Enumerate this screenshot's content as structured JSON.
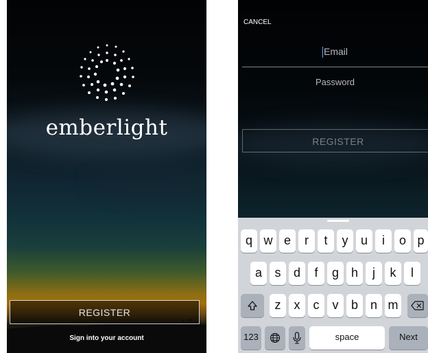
{
  "left_screen": {
    "brand_name": "emberlight",
    "register_button": "REGISTER",
    "sign_in_link": "Sign into your account",
    "logo_icon": "sun-dots-icon"
  },
  "right_screen": {
    "cancel_label": "CANCEL",
    "email_placeholder": "Email",
    "password_placeholder": "Password",
    "register_button": "REGISTER"
  },
  "keyboard": {
    "row1": [
      "q",
      "w",
      "e",
      "r",
      "t",
      "y",
      "u",
      "i",
      "o",
      "p"
    ],
    "row2": [
      "a",
      "s",
      "d",
      "f",
      "g",
      "h",
      "j",
      "k",
      "l"
    ],
    "row3": [
      "z",
      "x",
      "c",
      "v",
      "b",
      "n",
      "m"
    ],
    "numbers_key": "123",
    "space_key": "space",
    "next_key": "Next",
    "shift_icon": "shift-icon",
    "delete_icon": "delete-icon",
    "globe_icon": "globe-icon",
    "mic_icon": "microphone-icon"
  },
  "colors": {
    "caret": "#5aa6ff",
    "keyboard_bg": "#d1d4d9",
    "key_bg": "#ffffff",
    "function_key_bg": "#abb1ba"
  }
}
